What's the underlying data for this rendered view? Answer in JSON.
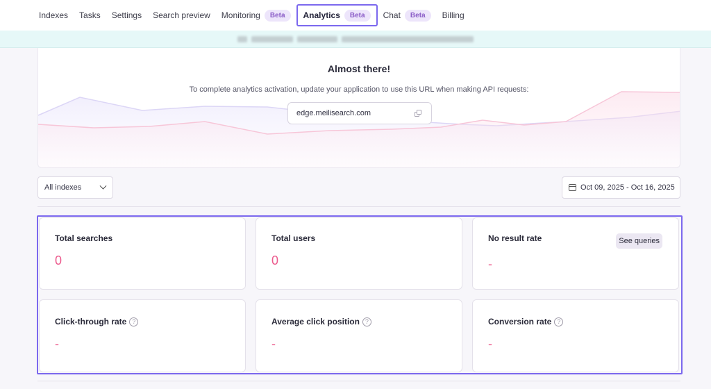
{
  "nav": {
    "items": [
      {
        "label": "Indexes"
      },
      {
        "label": "Tasks"
      },
      {
        "label": "Settings"
      },
      {
        "label": "Search preview"
      },
      {
        "label": "Monitoring",
        "badge": "Beta"
      },
      {
        "label": "Analytics",
        "badge": "Beta",
        "active": true
      },
      {
        "label": "Chat",
        "badge": "Beta"
      },
      {
        "label": "Billing"
      }
    ]
  },
  "activation": {
    "title": "Almost there!",
    "description": "To complete analytics activation, update your application to use this URL when making API requests:",
    "url": "edge.meilisearch.com"
  },
  "filters": {
    "index_select": "All indexes",
    "date_range": "Oct 09, 2025 - Oct 16, 2025"
  },
  "metrics": {
    "total_searches": {
      "title": "Total searches",
      "value": "0"
    },
    "total_users": {
      "title": "Total users",
      "value": "0"
    },
    "no_result_rate": {
      "title": "No result rate",
      "value": "-",
      "action": "See queries"
    },
    "click_through_rate": {
      "title": "Click-through rate",
      "value": "-"
    },
    "average_click_position": {
      "title": "Average click position",
      "value": "-"
    },
    "conversion_rate": {
      "title": "Conversion rate",
      "value": "-"
    }
  },
  "colors": {
    "accent": "#7b68ee",
    "badge_bg": "#ede5fb",
    "badge_text": "#8a5cc7",
    "metric_value": "#ec5a8d",
    "banner_bg": "#e6f8f8"
  },
  "icons": {
    "copy": "copy-icon",
    "chevron": "chevron-down-icon",
    "calendar": "calendar-icon",
    "help": "help-circle-icon"
  }
}
